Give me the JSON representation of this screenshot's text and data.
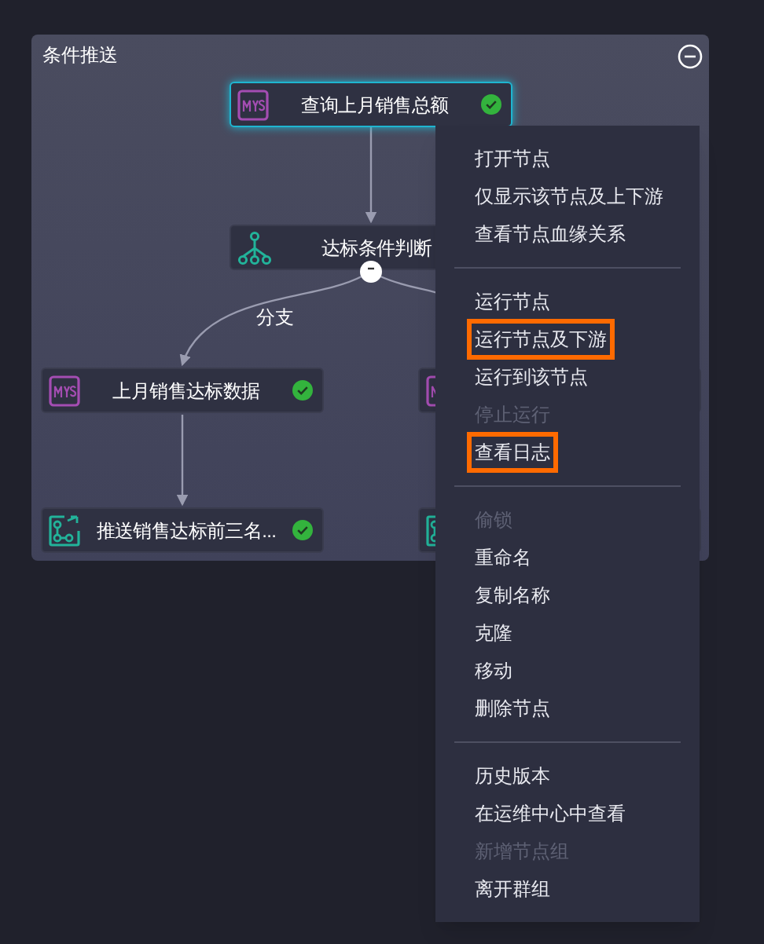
{
  "panel": {
    "title": "条件推送",
    "collapse_icon": true
  },
  "nodes": [
    {
      "kind": "mysql",
      "label": "查询上月销售总额",
      "selected": true,
      "succeeded": true
    },
    {
      "kind": "branch",
      "label": "达标条件判断",
      "selected": false
    },
    {
      "kind": "mysql",
      "label": "上月销售达标数据",
      "selected": false,
      "succeeded": true
    },
    {
      "kind": "mysql",
      "selected": false
    },
    {
      "kind": "push",
      "label": "推送销售达标前三名...",
      "selected": false,
      "succeeded": true
    },
    {
      "kind": "push",
      "selected": false
    }
  ],
  "edge_labels": [
    {
      "text": "分支"
    }
  ],
  "context_menu": {
    "groups": [
      [
        {
          "label": "打开节点",
          "disabled": false,
          "highlighted": false
        },
        {
          "label": "仅显示该节点及上下游",
          "disabled": false,
          "highlighted": false
        },
        {
          "label": "查看节点血缘关系",
          "disabled": false,
          "highlighted": false
        }
      ],
      [
        {
          "label": "运行节点",
          "disabled": false,
          "highlighted": false
        },
        {
          "label": "运行节点及下游",
          "disabled": false,
          "highlighted": true
        },
        {
          "label": "运行到该节点",
          "disabled": false,
          "highlighted": false
        },
        {
          "label": "停止运行",
          "disabled": true,
          "highlighted": false
        },
        {
          "label": "查看日志",
          "disabled": false,
          "highlighted": true
        }
      ],
      [
        {
          "label": "偷锁",
          "disabled": true,
          "highlighted": false
        },
        {
          "label": "重命名",
          "disabled": false,
          "highlighted": false
        },
        {
          "label": "复制名称",
          "disabled": false,
          "highlighted": false
        },
        {
          "label": "克隆",
          "disabled": false,
          "highlighted": false
        },
        {
          "label": "移动",
          "disabled": false,
          "highlighted": false
        },
        {
          "label": "删除节点",
          "disabled": false,
          "highlighted": false
        }
      ],
      [
        {
          "label": "历史版本",
          "disabled": false,
          "highlighted": false
        },
        {
          "label": "在运维中心中查看",
          "disabled": false,
          "highlighted": false
        },
        {
          "label": "新增节点组",
          "disabled": true,
          "highlighted": false
        },
        {
          "label": "离开群组",
          "disabled": false,
          "highlighted": false
        }
      ]
    ]
  }
}
